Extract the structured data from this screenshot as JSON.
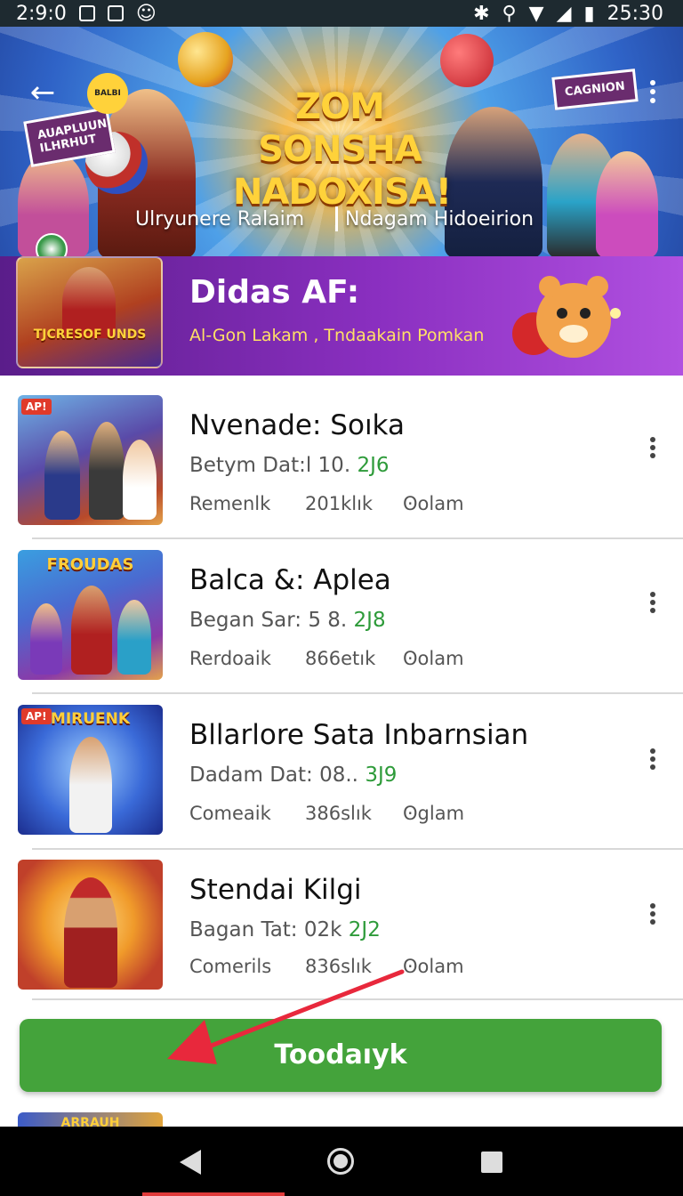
{
  "status_bar": {
    "time_left": "2:9:0",
    "time_right": "25:30"
  },
  "hero": {
    "title": "ZOM SONSHA NADOXISA!",
    "subtitle_left": "Ulryunere Ralaim",
    "subtitle_right": "Ndagam Hidoeirion",
    "sign_left": "AUAPLUUN ILHRHUT",
    "sign_right": "CAGNION",
    "badge": "BALBI"
  },
  "promo": {
    "title": "Didas AF:",
    "subtitle": "Al-Gon Lakam , Tndaakain Pomkan",
    "thumb_text": "TJCRESOF UNDS"
  },
  "items": [
    {
      "title": "Nvenade: Soıka",
      "meta_prefix": "Betym Dat:l 10.",
      "meta_green": "2J6",
      "stat1": "Remenlk",
      "stat2": "201klık",
      "stat3": "Ꙩolam",
      "badge": "AP!",
      "thumb_text": ""
    },
    {
      "title": "Balca &: Aplea",
      "meta_prefix": "Began Sar: 5 8.",
      "meta_green": "2J8",
      "stat1": "Rerdoaik",
      "stat2": "866etık",
      "stat3": "Ꙩolam",
      "badge": "",
      "thumb_text": "FROUDAS"
    },
    {
      "title": "Bllarlore Sata Inbarnsian",
      "meta_prefix": "Dadam Dat: 08..",
      "meta_green": "3J9",
      "stat1": "Comeaik",
      "stat2": "386slık",
      "stat3": "Ꙩglam",
      "badge": "AP!",
      "thumb_text": "MIRUENK"
    },
    {
      "title": "Stendai Kilgi",
      "meta_prefix": "Bagan Tat: 02k",
      "meta_green": "2J2",
      "stat1": "Comerils",
      "stat2": "836slık",
      "stat3": "Ꙩolam",
      "badge": "",
      "thumb_text": ""
    }
  ],
  "cta": {
    "label": "Toodaıyk"
  },
  "peek": {
    "text": "ARRAUH"
  }
}
